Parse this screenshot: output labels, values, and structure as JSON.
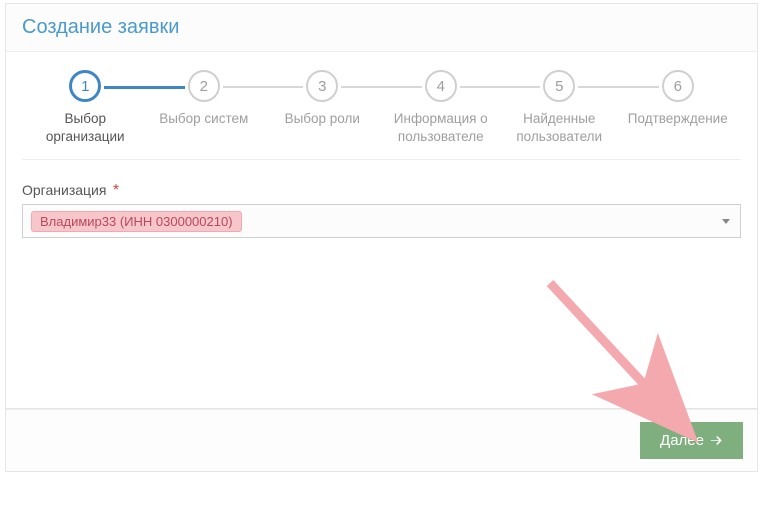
{
  "header": {
    "title": "Создание заявки"
  },
  "stepper": {
    "steps": [
      {
        "num": "1",
        "label": "Выбор организации",
        "active": true
      },
      {
        "num": "2",
        "label": "Выбор систем",
        "active": false
      },
      {
        "num": "3",
        "label": "Выбор роли",
        "active": false
      },
      {
        "num": "4",
        "label": "Информация о пользователе",
        "active": false
      },
      {
        "num": "5",
        "label": "Найденные пользователи",
        "active": false
      },
      {
        "num": "6",
        "label": "Подтверждение",
        "active": false
      }
    ]
  },
  "form": {
    "org_label": "Организация",
    "required_mark": "*",
    "org_selected": "Владимир33 (ИНН 0300000210)"
  },
  "actions": {
    "next_label": "Далее"
  },
  "annotation": {
    "arrow_color": "#f4a9ae"
  }
}
